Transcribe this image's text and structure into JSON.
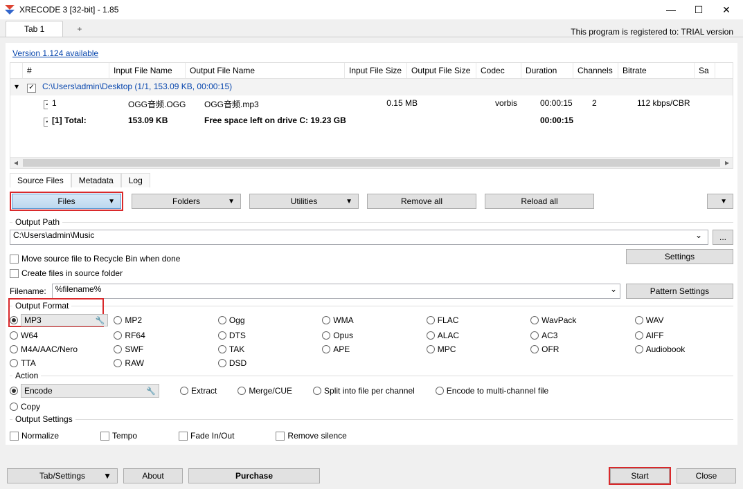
{
  "window": {
    "title": "XRECODE 3 [32-bit] - 1.85"
  },
  "tabs": {
    "tab1": "Tab 1",
    "plus": "+"
  },
  "trial_text": "This program is registered to: TRIAL version",
  "version_link": "Version 1.124 available",
  "columns": {
    "hash": "#",
    "input_name": "Input File Name",
    "output_name": "Output File Name",
    "input_size": "Input File Size",
    "output_size": "Output File Size",
    "codec": "Codec",
    "duration": "Duration",
    "channels": "Channels",
    "bitrate": "Bitrate",
    "sa": "Sa"
  },
  "folder_row": {
    "path": "C:\\Users\\admin\\Desktop (1/1, 153.09 KB, 00:00:15)"
  },
  "file_row": {
    "index": "1",
    "input": "OGG音频.OGG",
    "output": "OGG音频.mp3",
    "input_size": "0.15 MB",
    "codec": "vorbis",
    "duration": "00:00:15",
    "channels": "2",
    "bitrate": "112 kbps/CBR"
  },
  "total_row": {
    "label": "[1] Total:",
    "size": "153.09 KB",
    "free": "Free space left on drive C: 19.23 GB",
    "dur": "00:00:15"
  },
  "small_tabs": {
    "source": "Source Files",
    "meta": "Metadata",
    "log": "Log"
  },
  "dd": {
    "files": "Files",
    "folders": "Folders",
    "utilities": "Utilities",
    "remove_all": "Remove all",
    "reload_all": "Reload all"
  },
  "output_path": {
    "title": "Output Path",
    "value": "C:\\Users\\admin\\Music",
    "browse": "...",
    "recycle": "Move source file to Recycle Bin when done",
    "settings": "Settings",
    "create_src": "Create files in source folder",
    "filename_lbl": "Filename:",
    "filename_val": "%filename%",
    "pattern": "Pattern Settings"
  },
  "output_format": {
    "title": "Output Format",
    "items": [
      "MP3",
      "MP2",
      "Ogg",
      "WMA",
      "FLAC",
      "WavPack",
      "WAV",
      "W64",
      "RF64",
      "DTS",
      "Opus",
      "ALAC",
      "AC3",
      "AIFF",
      "M4A/AAC/Nero",
      "SWF",
      "TAK",
      "APE",
      "MPC",
      "OFR",
      "Audiobook",
      "TTA",
      "RAW",
      "DSD"
    ]
  },
  "action": {
    "title": "Action",
    "encode": "Encode",
    "extract": "Extract",
    "merge": "Merge/CUE",
    "split": "Split into file per channel",
    "multi": "Encode to multi-channel file",
    "copy": "Copy"
  },
  "output_settings": {
    "title": "Output Settings",
    "normalize": "Normalize",
    "tempo": "Tempo",
    "fade": "Fade In/Out",
    "silence": "Remove silence"
  },
  "bottom": {
    "tabset": "Tab/Settings",
    "about": "About",
    "purchase": "Purchase",
    "start": "Start",
    "close": "Close"
  }
}
